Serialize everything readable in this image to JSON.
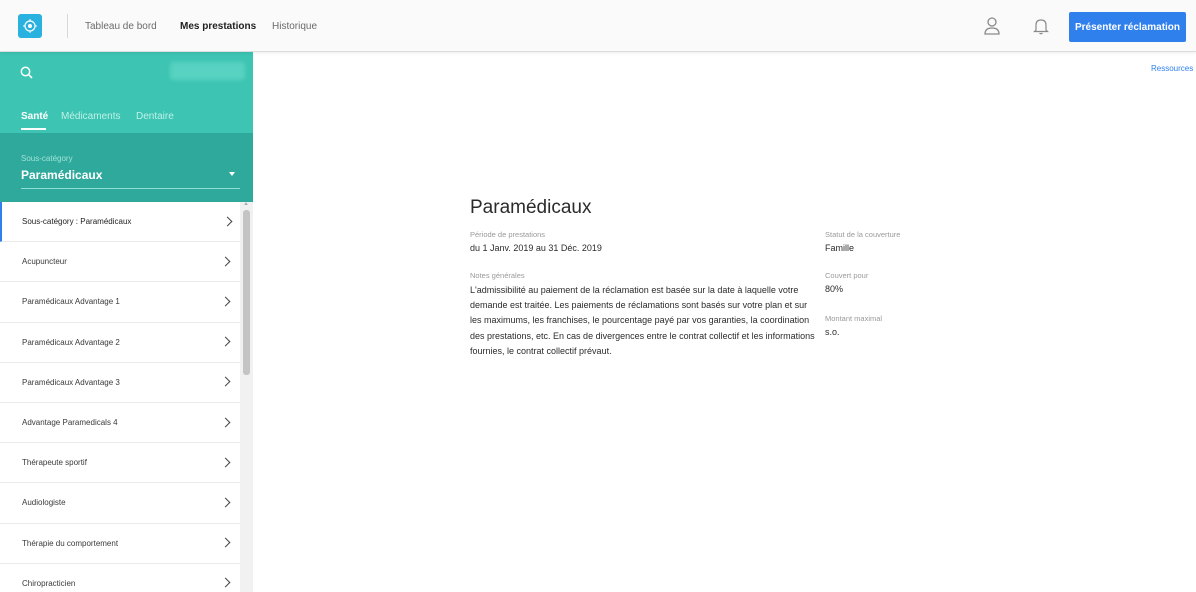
{
  "topbar": {
    "nav": [
      "Tableau de bord",
      "Mes prestations",
      "Historique"
    ],
    "cta_label": "Présenter réclamation"
  },
  "sidebar": {
    "tabs": [
      "Santé",
      "Médicaments",
      "Dentaire"
    ],
    "subcategory_label": "Sous-catégory",
    "subcategory_value": "Paramédicaux",
    "items": [
      "Sous-catégory : Paramédicaux",
      "Acupuncteur",
      "Paramédicaux Advantage 1",
      "Paramédicaux Advantage 2",
      "Paramédicaux Advantage 3",
      "Advantage Paramedicals 4",
      "Thérapeute sportif",
      "Audiologiste",
      "Thérapie du comportement",
      "Chiropracticien"
    ]
  },
  "main": {
    "resources_link": "Ressources",
    "title": "Paramédicaux",
    "period_label": "Période de prestations",
    "period_value": "du 1 Janv. 2019 au 31 Déc. 2019",
    "notes_label": "Notes générales",
    "notes_text": "L'admissibilité au paiement de la réclamation est basée sur la date à laquelle votre demande est traitée. Les paiements de réclamations sont basés sur votre plan et sur les maximums, les franchises, le pourcentage payé par vos garanties, la coordination des prestations, etc. En cas de divergences entre le contrat collectif et les informations fournies, le contrat collectif prévaut.",
    "coverage_status_label": "Statut de la couverture",
    "coverage_status_value": "Famille",
    "covered_for_label": "Couvert pour",
    "covered_for_value": "80%",
    "max_amount_label": "Montant maximal",
    "max_amount_value": "s.o."
  },
  "colors": {
    "accent": "#2f80ed",
    "sidebar_teal": "#3dc4b2",
    "sidebar_teal_dark": "#2fa99b"
  }
}
